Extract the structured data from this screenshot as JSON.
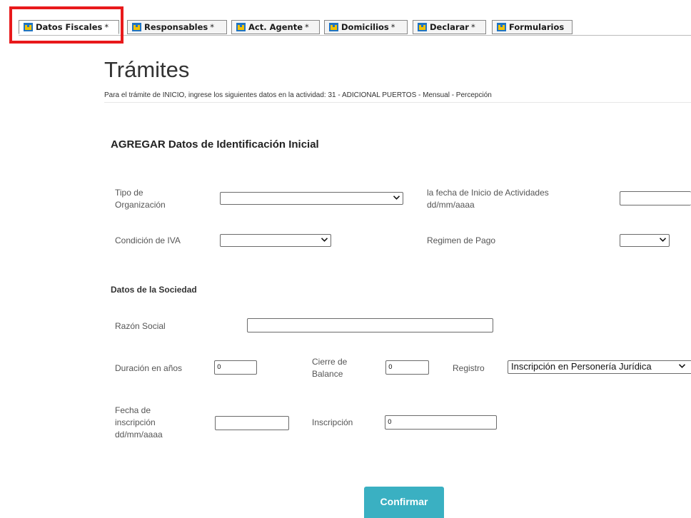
{
  "tabs": [
    {
      "label": "Datos Fiscales",
      "star": "*",
      "active": true
    },
    {
      "label": "Responsables",
      "star": "*"
    },
    {
      "label": "Act. Agente",
      "star": "*"
    },
    {
      "label": "Domicilios",
      "star": "*"
    },
    {
      "label": "Declarar",
      "star": "*"
    },
    {
      "label": "Formularios",
      "star": ""
    }
  ],
  "page": {
    "title": "Trámites",
    "subtitle": "Para el trámite de INICIO, ingrese los siguientes datos en la actividad: 31 - ADICIONAL PUERTOS - Mensual - Percepción"
  },
  "form": {
    "section_title": "AGREGAR Datos de Identificación Inicial",
    "tipo_org_label_1": "Tipo de",
    "tipo_org_label_2": "Organización",
    "tipo_org_value": "",
    "fecha_inicio_label_1": "la fecha de Inicio de Actividades",
    "fecha_inicio_label_2": "dd/mm/aaaa",
    "fecha_inicio_value": "",
    "condicion_iva_label": "Condición de IVA",
    "condicion_iva_value": "",
    "regimen_pago_label": "Regimen de Pago",
    "regimen_pago_value": "",
    "sociedad_title": "Datos de la Sociedad",
    "razon_social_label": "Razón Social",
    "razon_social_value": "",
    "duracion_label": "Duración en años",
    "duracion_value": "0",
    "cierre_label_1": "Cierre de",
    "cierre_label_2": "Balance",
    "cierre_value": "0",
    "registro_label": "Registro",
    "registro_value": "Inscripción en Personería Jurídica",
    "fecha_insc_label_1": "Fecha de",
    "fecha_insc_label_2": "inscripción",
    "fecha_insc_label_3": "dd/mm/aaaa",
    "fecha_insc_value": "",
    "inscripcion_label": "Inscripción",
    "inscripcion_value": "0",
    "confirm_label": "Confirmar"
  },
  "colors": {
    "highlight": "#e8191b",
    "confirm_button": "#3ab0c2",
    "tab_icon_blue": "#1f74c4",
    "tab_icon_yellow": "#f2c200"
  },
  "icons": {
    "tab_icon": "form-download-icon",
    "select_arrow": "chevron-down-icon"
  }
}
